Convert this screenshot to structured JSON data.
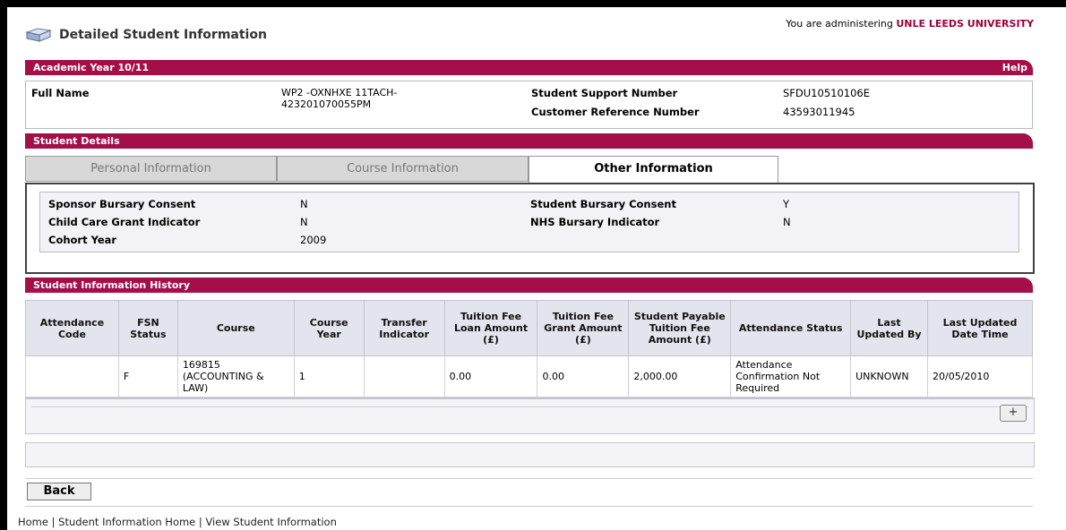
{
  "header": {
    "admin_prefix": "You are administering ",
    "admin_org": "UNLE LEEDS UNIVERSITY",
    "title": "Detailed Student Information"
  },
  "academic": {
    "band_label": "Academic Year  10/11",
    "help": "Help",
    "full_name_label": "Full Name",
    "full_name_value": "WP2 -OXNHXE 11TACH-423201070055PM",
    "ssn_label": "Student Support Number",
    "ssn_value": "SFDU10510106E",
    "crn_label": "Customer Reference Number",
    "crn_value": "43593011945"
  },
  "student_details": {
    "band_label": "Student Details",
    "tabs": [
      "Personal Information",
      "Course Information",
      "Other Information"
    ],
    "sponsor_label": "Sponsor Bursary Consent",
    "sponsor_value": "N",
    "student_bursary_label": "Student Bursary Consent",
    "student_bursary_value": "Y",
    "child_care_label": "Child Care Grant Indicator",
    "child_care_value": "N",
    "nhs_label": "NHS Bursary Indicator",
    "nhs_value": "N",
    "cohort_label": "Cohort Year",
    "cohort_value": "2009"
  },
  "history": {
    "band_label": "Student Information History",
    "columns": [
      "Attendance Code",
      "FSN Status",
      "Course",
      "Course Year",
      "Transfer Indicator",
      "Tuition Fee Loan Amount (£)",
      "Tuition Fee Grant Amount (£)",
      "Student Payable Tuition Fee Amount (£)",
      "Attendance Status",
      "Last Updated By",
      "Last Updated Date Time"
    ],
    "rows": [
      [
        "",
        "F",
        "169815 (ACCOUNTING & LAW)",
        "1",
        "",
        "0.00",
        "0.00",
        "2,000.00",
        "Attendance Confirmation Not Required",
        "UNKNOWN",
        "20/05/2010"
      ]
    ],
    "add_button": "+"
  },
  "footer": {
    "back_label": "Back",
    "breadcrumbs": "Home | Student Information Home | View Student Information"
  },
  "colors": {
    "accent": "#a40f4a",
    "admin_org": "#a0003a"
  }
}
